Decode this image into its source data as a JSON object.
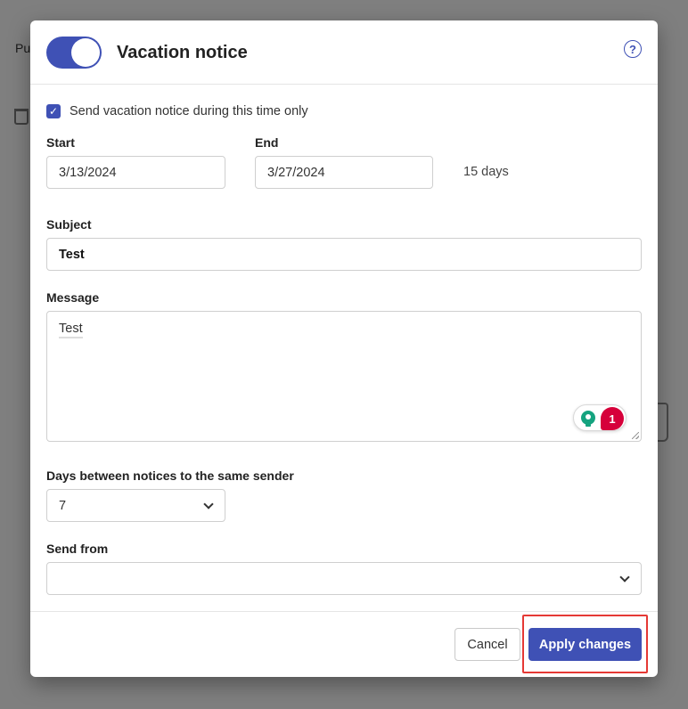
{
  "background": {
    "partial_text": "Pu"
  },
  "dialog": {
    "title": "Vacation notice",
    "toggle_on": true,
    "help_icon": "?",
    "date_range_checkbox": {
      "checked": true,
      "label": "Send vacation notice during this time only"
    },
    "start": {
      "label": "Start",
      "value": "3/13/2024"
    },
    "end": {
      "label": "End",
      "value": "3/27/2024"
    },
    "duration": "15 days",
    "subject": {
      "label": "Subject",
      "value": "Test"
    },
    "message": {
      "label": "Message",
      "value": "Test",
      "grammar_issue_count": "1"
    },
    "days_between": {
      "label": "Days between notices to the same sender",
      "value": "7"
    },
    "send_from": {
      "label": "Send from",
      "value": ""
    },
    "buttons": {
      "cancel": "Cancel",
      "apply": "Apply changes"
    }
  },
  "colors": {
    "accent": "#3f51b5",
    "highlight": "#e53935",
    "grammar_badge": "#d6003a",
    "grammar_bulb": "#15a37f"
  }
}
